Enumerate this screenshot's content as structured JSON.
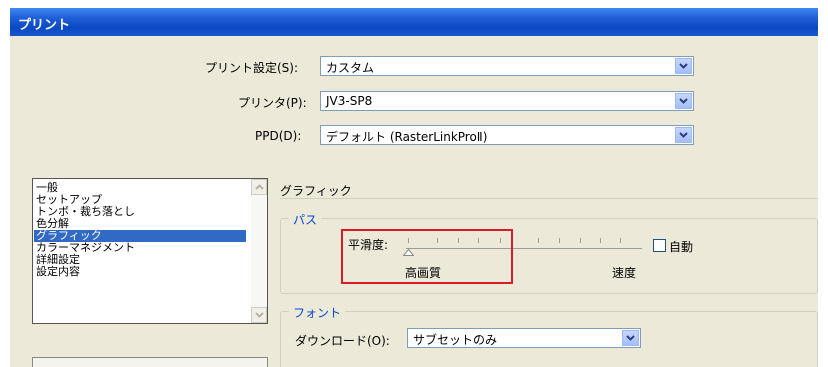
{
  "window": {
    "title": "プリント"
  },
  "print_settings": {
    "label": "プリント設定(S):",
    "value": "カスタム"
  },
  "printer": {
    "label": "プリンタ(P):",
    "value": "JV3-SP8"
  },
  "ppd": {
    "label": "PPD(D):",
    "value": "デフォルト (RasterLinkProⅡ)"
  },
  "categories": {
    "items": [
      "一般",
      "セットアップ",
      "トンボ・裁ち落とし",
      "色分解",
      "グラフィック",
      "カラーマネジメント",
      "詳細設定",
      "設定内容"
    ],
    "selected": "グラフィック"
  },
  "panel": {
    "heading": "グラフィック"
  },
  "path_group": {
    "title": "パス",
    "smoothness_label": "平滑度:",
    "left_label": "高画質",
    "right_label": "速度",
    "auto_label": "自動",
    "auto_checked": false,
    "slider_value": 0
  },
  "font_group": {
    "title": "フォント",
    "download_label": "ダウンロード(O):",
    "download_value": "サブセットのみ"
  },
  "colors": {
    "titlebar": "#0b49c4",
    "dialog_bg": "#ece9d8",
    "selection": "#316ac5",
    "group_title": "#0046d5",
    "highlight": "#d81b24"
  }
}
